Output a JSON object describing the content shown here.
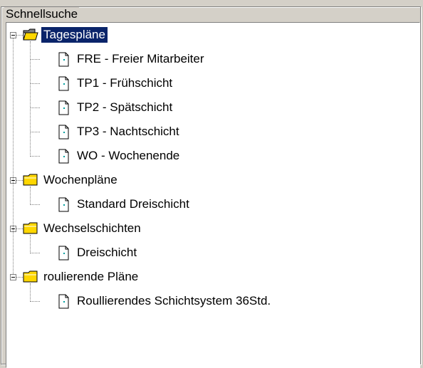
{
  "panel": {
    "title": "Schnellsuche"
  },
  "tree": [
    {
      "label": "Tagespläne",
      "icon": "folder-open-icon",
      "expanded": true,
      "selected": true,
      "children": [
        {
          "label": "FRE - Freier Mitarbeiter",
          "icon": "document-icon"
        },
        {
          "label": "TP1 - Frühschicht",
          "icon": "document-icon"
        },
        {
          "label": "TP2 - Spätschicht",
          "icon": "document-icon"
        },
        {
          "label": "TP3 - Nachtschicht",
          "icon": "document-icon"
        },
        {
          "label": "WO - Wochenende",
          "icon": "document-icon"
        }
      ]
    },
    {
      "label": "Wochenpläne",
      "icon": "folder-closed-icon",
      "expanded": true,
      "children": [
        {
          "label": "Standard Dreischicht",
          "icon": "document-icon"
        }
      ]
    },
    {
      "label": "Wechselschichten",
      "icon": "folder-closed-icon",
      "expanded": true,
      "children": [
        {
          "label": "Dreischicht",
          "icon": "document-icon"
        }
      ]
    },
    {
      "label": "roulierende Pläne",
      "icon": "folder-closed-icon",
      "expanded": true,
      "children": [
        {
          "label": "Roullierendes Schichtsystem 36Std.",
          "icon": "document-icon"
        }
      ]
    }
  ],
  "colors": {
    "selection": "#0a246a",
    "folder": "#ffd700",
    "face": "#d4d0c8"
  }
}
